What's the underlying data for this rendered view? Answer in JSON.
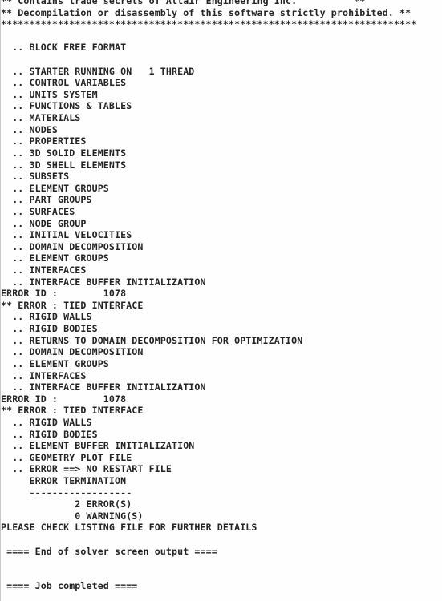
{
  "window": {
    "type": "solver-console-output",
    "program": "Altair Radioss Starter",
    "background_color": "#fefefe",
    "text_color": "#232326"
  },
  "console": {
    "lines": [
      "** Contains trade secrets of Altair Engineering Inc.          **",
      "** Decompilation or disassembly of this software strictly prohibited. **",
      "*************************************************************************",
      "",
      "  .. BLOCK FREE FORMAT",
      "",
      "  .. STARTER RUNNING ON   1 THREAD",
      "  .. CONTROL VARIABLES",
      "  .. UNITS SYSTEM",
      "  .. FUNCTIONS & TABLES",
      "  .. MATERIALS",
      "  .. NODES",
      "  .. PROPERTIES",
      "  .. 3D SOLID ELEMENTS",
      "  .. 3D SHELL ELEMENTS",
      "  .. SUBSETS",
      "  .. ELEMENT GROUPS",
      "  .. PART GROUPS",
      "  .. SURFACES",
      "  .. NODE GROUP",
      "  .. INITIAL VELOCITIES",
      "  .. DOMAIN DECOMPOSITION",
      "  .. ELEMENT GROUPS",
      "  .. INTERFACES",
      "  .. INTERFACE BUFFER INITIALIZATION",
      "ERROR ID :        1078",
      "** ERROR : TIED INTERFACE",
      "  .. RIGID WALLS",
      "  .. RIGID BODIES",
      "  .. RETURNS TO DOMAIN DECOMPOSITION FOR OPTIMIZATION",
      "  .. DOMAIN DECOMPOSITION",
      "  .. ELEMENT GROUPS",
      "  .. INTERFACES",
      "  .. INTERFACE BUFFER INITIALIZATION",
      "ERROR ID :        1078",
      "** ERROR : TIED INTERFACE",
      "  .. RIGID WALLS",
      "  .. RIGID BODIES",
      "  .. ELEMENT BUFFER INITIALIZATION",
      "  .. GEOMETRY PLOT FILE",
      "  .. ERROR ==> NO RESTART FILE",
      "     ERROR TERMINATION",
      "     ------------------",
      "             2 ERROR(S)",
      "             0 WARNING(S)",
      "PLEASE CHECK LISTING FILE FOR FURTHER DETAILS",
      "",
      " ==== End of solver screen output ====",
      "",
      "",
      " ==== Job completed ===="
    ],
    "summary": {
      "error_id": "1078",
      "error_message": "** ERROR : TIED INTERFACE",
      "error_count": "2 ERROR(S)",
      "warning_count": "0 WARNING(S)",
      "termination_status": "ERROR TERMINATION",
      "details_hint": "PLEASE CHECK LISTING FILE FOR FURTHER DETAILS",
      "end_marker": " ==== End of solver screen output ====",
      "job_marker": " ==== Job completed ===="
    }
  }
}
